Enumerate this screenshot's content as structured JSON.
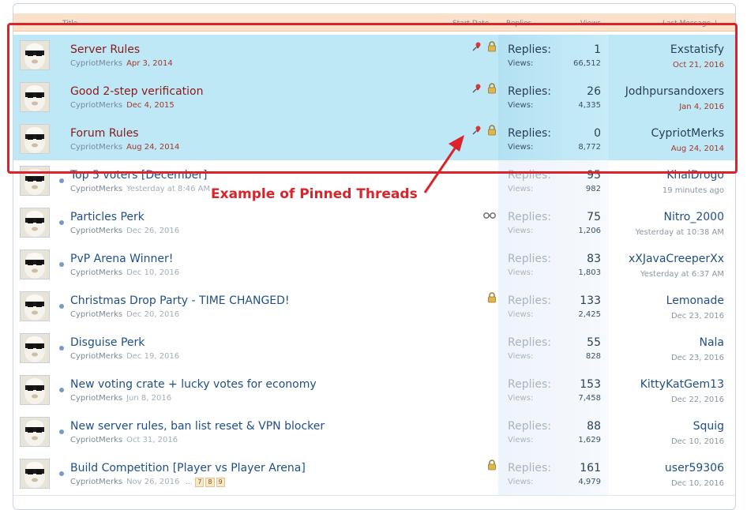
{
  "header": {
    "title": "Title",
    "start_date": "Start Date",
    "replies": "Replies",
    "views": "Views",
    "last_message": "Last Message ↓"
  },
  "labels": {
    "replies": "Replies:",
    "views": "Views:"
  },
  "annotation": {
    "text": "Example of Pinned Threads",
    "color": "#d8242a"
  },
  "colors": {
    "sticky_bg": "#bee8f5",
    "header_bg": "#fbe1c9",
    "link": "#1f4f86",
    "sticky_title": "#8a1a1a"
  },
  "threads": [
    {
      "title": "Server Rules",
      "author": "CypriotMerks",
      "date": "Apr 3, 2014",
      "replies": "1",
      "views": "66,512",
      "last_user": "Exstatisfy",
      "last_date": "Oct 21, 2016",
      "sticky": true,
      "icons": [
        "pin-icon",
        "lock-icon"
      ]
    },
    {
      "title": "Good 2-step verification",
      "author": "CypriotMerks",
      "date": "Dec 4, 2015",
      "replies": "26",
      "views": "4,335",
      "last_user": "Jodhpursandoxers",
      "last_date": "Jan 4, 2016",
      "sticky": true,
      "icons": [
        "pin-icon",
        "lock-icon"
      ]
    },
    {
      "title": "Forum Rules",
      "author": "CypriotMerks",
      "date": "Aug 24, 2014",
      "replies": "0",
      "views": "8,772",
      "last_user": "CypriotMerks",
      "last_date": "Aug 24, 2014",
      "sticky": true,
      "icons": [
        "pin-icon",
        "lock-icon"
      ]
    },
    {
      "title": "Top 5 voters [December]",
      "author": "CypriotMerks",
      "date": "Yesterday at 8:46 AM",
      "replies": "95",
      "views": "982",
      "last_user": "KhalDrogo",
      "last_date": "19 minutes ago",
      "sticky": false,
      "icons": []
    },
    {
      "title": "Particles Perk",
      "author": "CypriotMerks",
      "date": "Dec 26, 2016",
      "replies": "75",
      "views": "1,206",
      "last_user": "Nitro_2000",
      "last_date": "Yesterday at 10:38 AM",
      "sticky": false,
      "icons": [
        "watching-icon"
      ]
    },
    {
      "title": "PvP Arena Winner!",
      "author": "CypriotMerks",
      "date": "Dec 10, 2016",
      "replies": "83",
      "views": "1,803",
      "last_user": "xXJavaCreeperXx",
      "last_date": "Yesterday at 6:37 AM",
      "sticky": false,
      "icons": []
    },
    {
      "title": "Christmas Drop Party - TIME CHANGED!",
      "author": "CypriotMerks",
      "date": "Dec 20, 2016",
      "replies": "133",
      "views": "2,425",
      "last_user": "Lemonade",
      "last_date": "Dec 23, 2016",
      "sticky": false,
      "icons": [
        "lock-icon"
      ]
    },
    {
      "title": "Disguise Perk",
      "author": "CypriotMerks",
      "date": "Dec 19, 2016",
      "replies": "55",
      "views": "828",
      "last_user": "Nala",
      "last_date": "Dec 23, 2016",
      "sticky": false,
      "icons": []
    },
    {
      "title": "New voting crate + lucky votes for economy",
      "author": "CypriotMerks",
      "date": "Jun 8, 2016",
      "replies": "153",
      "views": "7,458",
      "last_user": "KittyKatGem13",
      "last_date": "Dec 22, 2016",
      "sticky": false,
      "icons": []
    },
    {
      "title": "New server rules, ban list reset & VPN blocker",
      "author": "CypriotMerks",
      "date": "Oct 31, 2016",
      "replies": "88",
      "views": "1,629",
      "last_user": "Squig",
      "last_date": "Dec 10, 2016",
      "sticky": false,
      "icons": []
    },
    {
      "title": "Build Competition [Player vs Player Arena]",
      "author": "CypriotMerks",
      "date": "Nov 26, 2016",
      "pages_ellipsis": "…",
      "pages": [
        "7",
        "8",
        "9"
      ],
      "replies": "161",
      "views": "4,979",
      "last_user": "user59306",
      "last_date": "Dec 10, 2016",
      "sticky": false,
      "icons": [
        "lock-icon"
      ]
    }
  ]
}
